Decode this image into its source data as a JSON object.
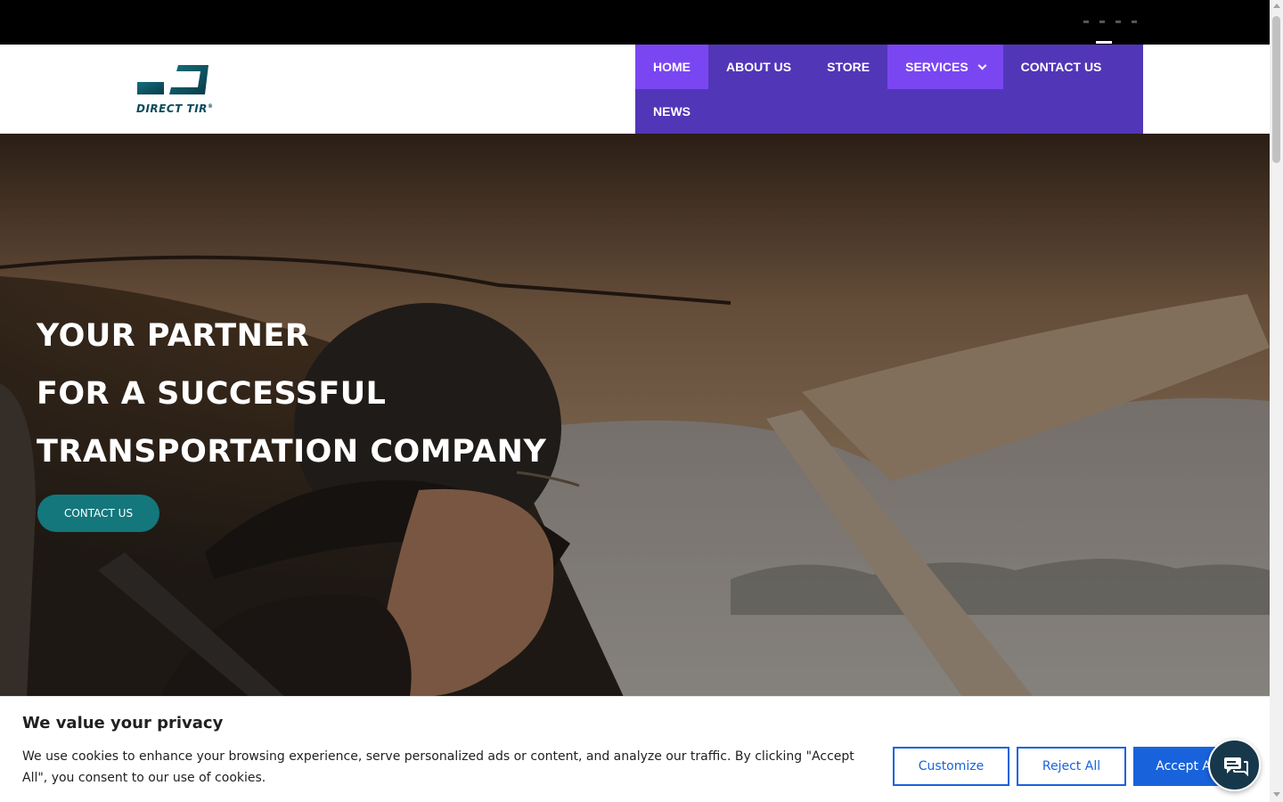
{
  "header": {
    "logo_text": "DIRECT TIR",
    "logo_mark": "®",
    "brand_colors": {
      "logo": "#0b4a5a",
      "nav_bg": "#5236b8",
      "nav_active": "#7a46f2"
    }
  },
  "nav": {
    "items": [
      {
        "label": "HOME",
        "active": true
      },
      {
        "label": "ABOUT US",
        "active": false
      },
      {
        "label": "STORE",
        "active": false
      },
      {
        "label": "SERVICES",
        "active": true,
        "has_dropdown": true
      },
      {
        "label": "CONTACT US",
        "active": false
      },
      {
        "label": "NEWS",
        "active": false
      }
    ]
  },
  "hero": {
    "lines": [
      "YOUR PARTNER",
      "FOR A SUCCESSFUL",
      "TRANSPORTATION COMPANY"
    ],
    "cta_label": "CONTACT US",
    "cta_color": "#13777c"
  },
  "cookie": {
    "title": "We value your privacy",
    "text": "We use cookies to enhance your browsing experience, serve personalized ads or content, and analyze our traffic. By clicking \"Accept All\", you consent to our use of cookies.",
    "customize_label": "Customize",
    "reject_label": "Reject All",
    "accept_label": "Accept All",
    "accent_color": "#1863dc"
  },
  "chat": {
    "icon": "chat-bubble-icon",
    "color": "#17384b"
  }
}
